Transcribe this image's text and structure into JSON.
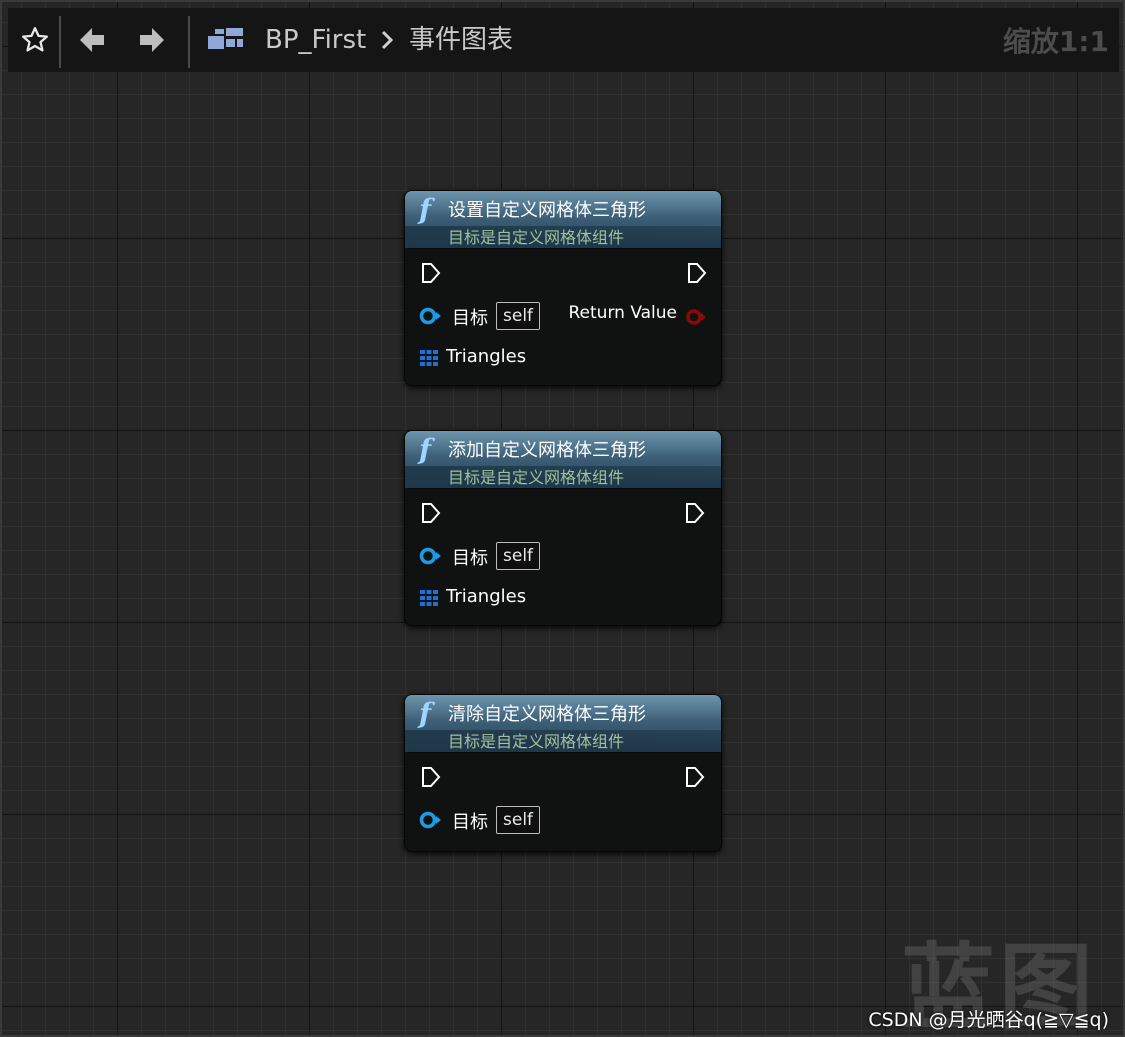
{
  "toolbar": {
    "breadcrumb_root": "BP_First",
    "breadcrumb_separator_icon": "chevron-right-icon",
    "breadcrumb_current": "事件图表",
    "zoom_label": "缩放1:1"
  },
  "nodes": [
    {
      "title": "设置自定义网格体三角形",
      "subtitle": "目标是自定义网格体组件",
      "target_label": "目标",
      "target_value": "self",
      "return_label": "Return Value",
      "array_label": "Triangles"
    },
    {
      "title": "添加自定义网格体三角形",
      "subtitle": "目标是自定义网格体组件",
      "target_label": "目标",
      "target_value": "self",
      "array_label": "Triangles"
    },
    {
      "title": "清除自定义网格体三角形",
      "subtitle": "目标是自定义网格体组件",
      "target_label": "目标",
      "target_value": "self"
    }
  ],
  "watermark": "蓝图",
  "credit": "CSDN @月光晒谷q(≧▽≦q)",
  "colors": {
    "object_pin": "#1e9be6",
    "array_pin": "#1e6fd6",
    "boolean_pin": "#8a0a0a",
    "exec_pin": "#ffffff"
  }
}
